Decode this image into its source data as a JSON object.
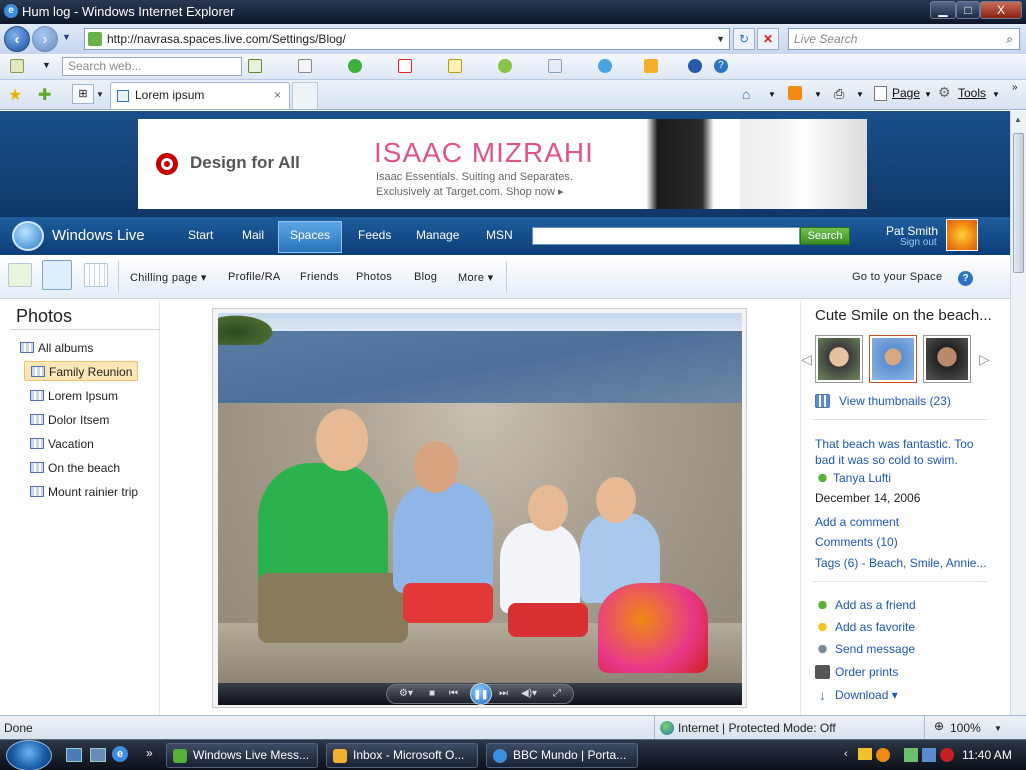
{
  "window": {
    "title": "Hum log - Windows Internet Explorer",
    "min": "▁",
    "max": "□",
    "close": "X"
  },
  "address": {
    "url": "http://navrasa.spaces.live.com/Settings/Blog/",
    "live_search_placeholder": "Live Search"
  },
  "toolbar": {
    "search_placeholder": "Search web..."
  },
  "tab": {
    "label": "Lorem ipsum",
    "close": "×"
  },
  "commands": {
    "page": "Page",
    "tools": "Tools"
  },
  "ad": {
    "tagline": "Design for All",
    "brand": "ISAAC MIZRAHI",
    "line1": "Isaac Essentials. Suiting and Separates.",
    "line2": "Exclusively at Target.com. Shop now ▸"
  },
  "wl": {
    "logo_text": "Windows Live",
    "nav": [
      "Start",
      "Mail",
      "Spaces",
      "Feeds",
      "Manage",
      "MSN"
    ],
    "search_button": "Search",
    "user": "Pat Smith",
    "sign_out": "Sign out"
  },
  "space_nav": {
    "items": [
      "Chilling page ▾",
      "Profile/RA",
      "Friends",
      "Photos",
      "Blog",
      "More ▾"
    ],
    "go_to_space": "Go to your Space"
  },
  "photos": {
    "heading": "Photos",
    "albums": [
      "All albums",
      "Family Reunion",
      "Lorem Ipsum",
      "Dolor Itsem",
      "Vacation",
      "On the beach",
      "Mount rainier trip"
    ],
    "selected": "Family Reunion"
  },
  "right": {
    "title": "Cute Smile on the beach...",
    "view_thumbnails": "View thumbnails (23)",
    "caption_line1": "That beach was fantastic. Too",
    "caption_line2": "bad it was so cold to swim.",
    "author": "Tanya Lufti",
    "date": "December 14, 2006",
    "add_comment": "Add a comment",
    "comments": "Comments (10)",
    "tags": "Tags (6) - Beach, Smile, Annie...",
    "actions": [
      "Add as a friend",
      "Add as favorite",
      "Send message",
      "Order prints",
      "Download ▾"
    ]
  },
  "status": {
    "left": "Done",
    "zone": "Internet | Protected Mode: Off",
    "zoom": "100%"
  },
  "taskbar": {
    "tasks": [
      "Windows Live Mess...",
      "Inbox - Microsoft O...",
      "BBC Mundo | Porta..."
    ],
    "clock": "11:40 AM"
  },
  "colors": {
    "link": "#1e58b0",
    "wl_bar": "#0d3e78",
    "accent_pink": "#e0528a",
    "target_red": "#c40000"
  }
}
